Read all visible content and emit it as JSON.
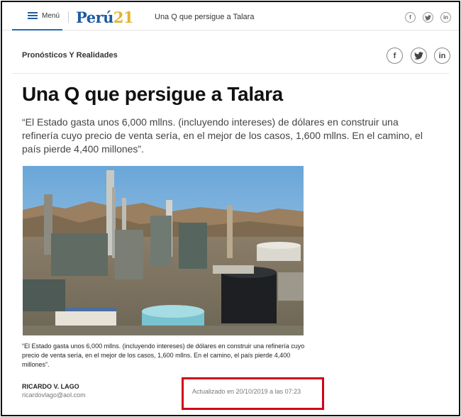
{
  "topbar": {
    "menu_label": "Menú",
    "logo_part1": "Perú",
    "logo_part2": "21",
    "title": "Una Q que persigue a Talara",
    "social_icons": [
      "facebook-icon",
      "twitter-icon",
      "linkedin-icon"
    ]
  },
  "article": {
    "section": "Pronósticos Y Realidades",
    "headline": "Una Q que persigue a Talara",
    "lead": "“El Estado gasta unos 6,000 mllns. (incluyendo intereses) de dólares en construir una refinería cuyo precio de venta sería, en el mejor de los casos, 1,600 mllns. En el camino, el país pierde 4,400 millones”.",
    "image_subject": "refinery-photo",
    "caption": "“El Estado gasta unos 6,000 mllns. (incluyendo intereses) de dólares en construir una refinería cuyo precio de venta sería, en el mejor de los casos, 1,600 mllns. En el camino, el país pierde 4,400 millones”.",
    "author": "RICARDO V. LAGO",
    "email": "ricardovlago@aol.com",
    "updated": "Actualizado en 20/10/2019 a las 07:23"
  },
  "colors": {
    "brand_blue": "#1f5ba3",
    "brand_yellow": "#e5b32a",
    "highlight_red": "#d0021b"
  }
}
